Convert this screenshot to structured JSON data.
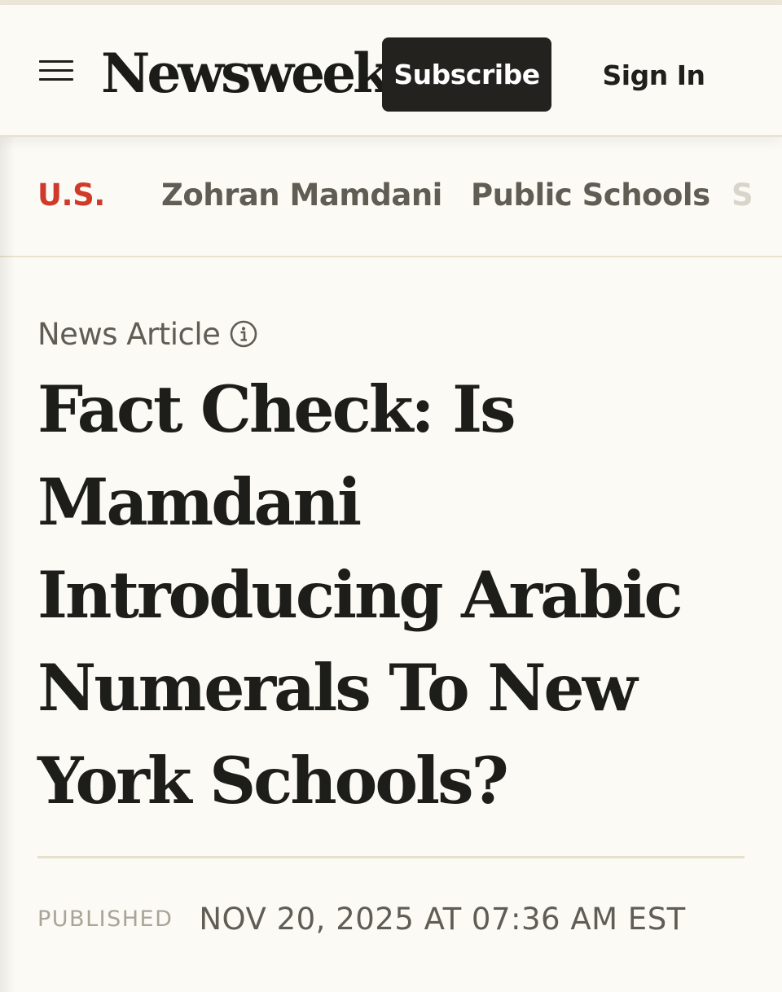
{
  "header": {
    "logo_text": "Newsweek",
    "subscribe_label": "Subscribe",
    "signin_label": "Sign In",
    "menu_icon": "hamburger-menu-icon"
  },
  "topics": [
    {
      "label": "U.S.",
      "active": true
    },
    {
      "label": "Zohran Mamdani",
      "active": false
    },
    {
      "label": "Public Schools",
      "active": false
    },
    {
      "label": "S",
      "active": false
    }
  ],
  "article": {
    "type_label": "News Article",
    "type_icon": "info-icon",
    "headline": "Fact Check: Is Mamdani Introducing Arabic Numerals To New York Schools?",
    "published_label": "PUBLISHED",
    "published_date": "NOV 20, 2025 AT 07:36 AM EST"
  },
  "colors": {
    "background": "#fbfaf5",
    "accent_red": "#cf3a2b",
    "dark_button": "#23221e",
    "muted_text": "#5f5d54",
    "divider": "#e6e0cc"
  }
}
